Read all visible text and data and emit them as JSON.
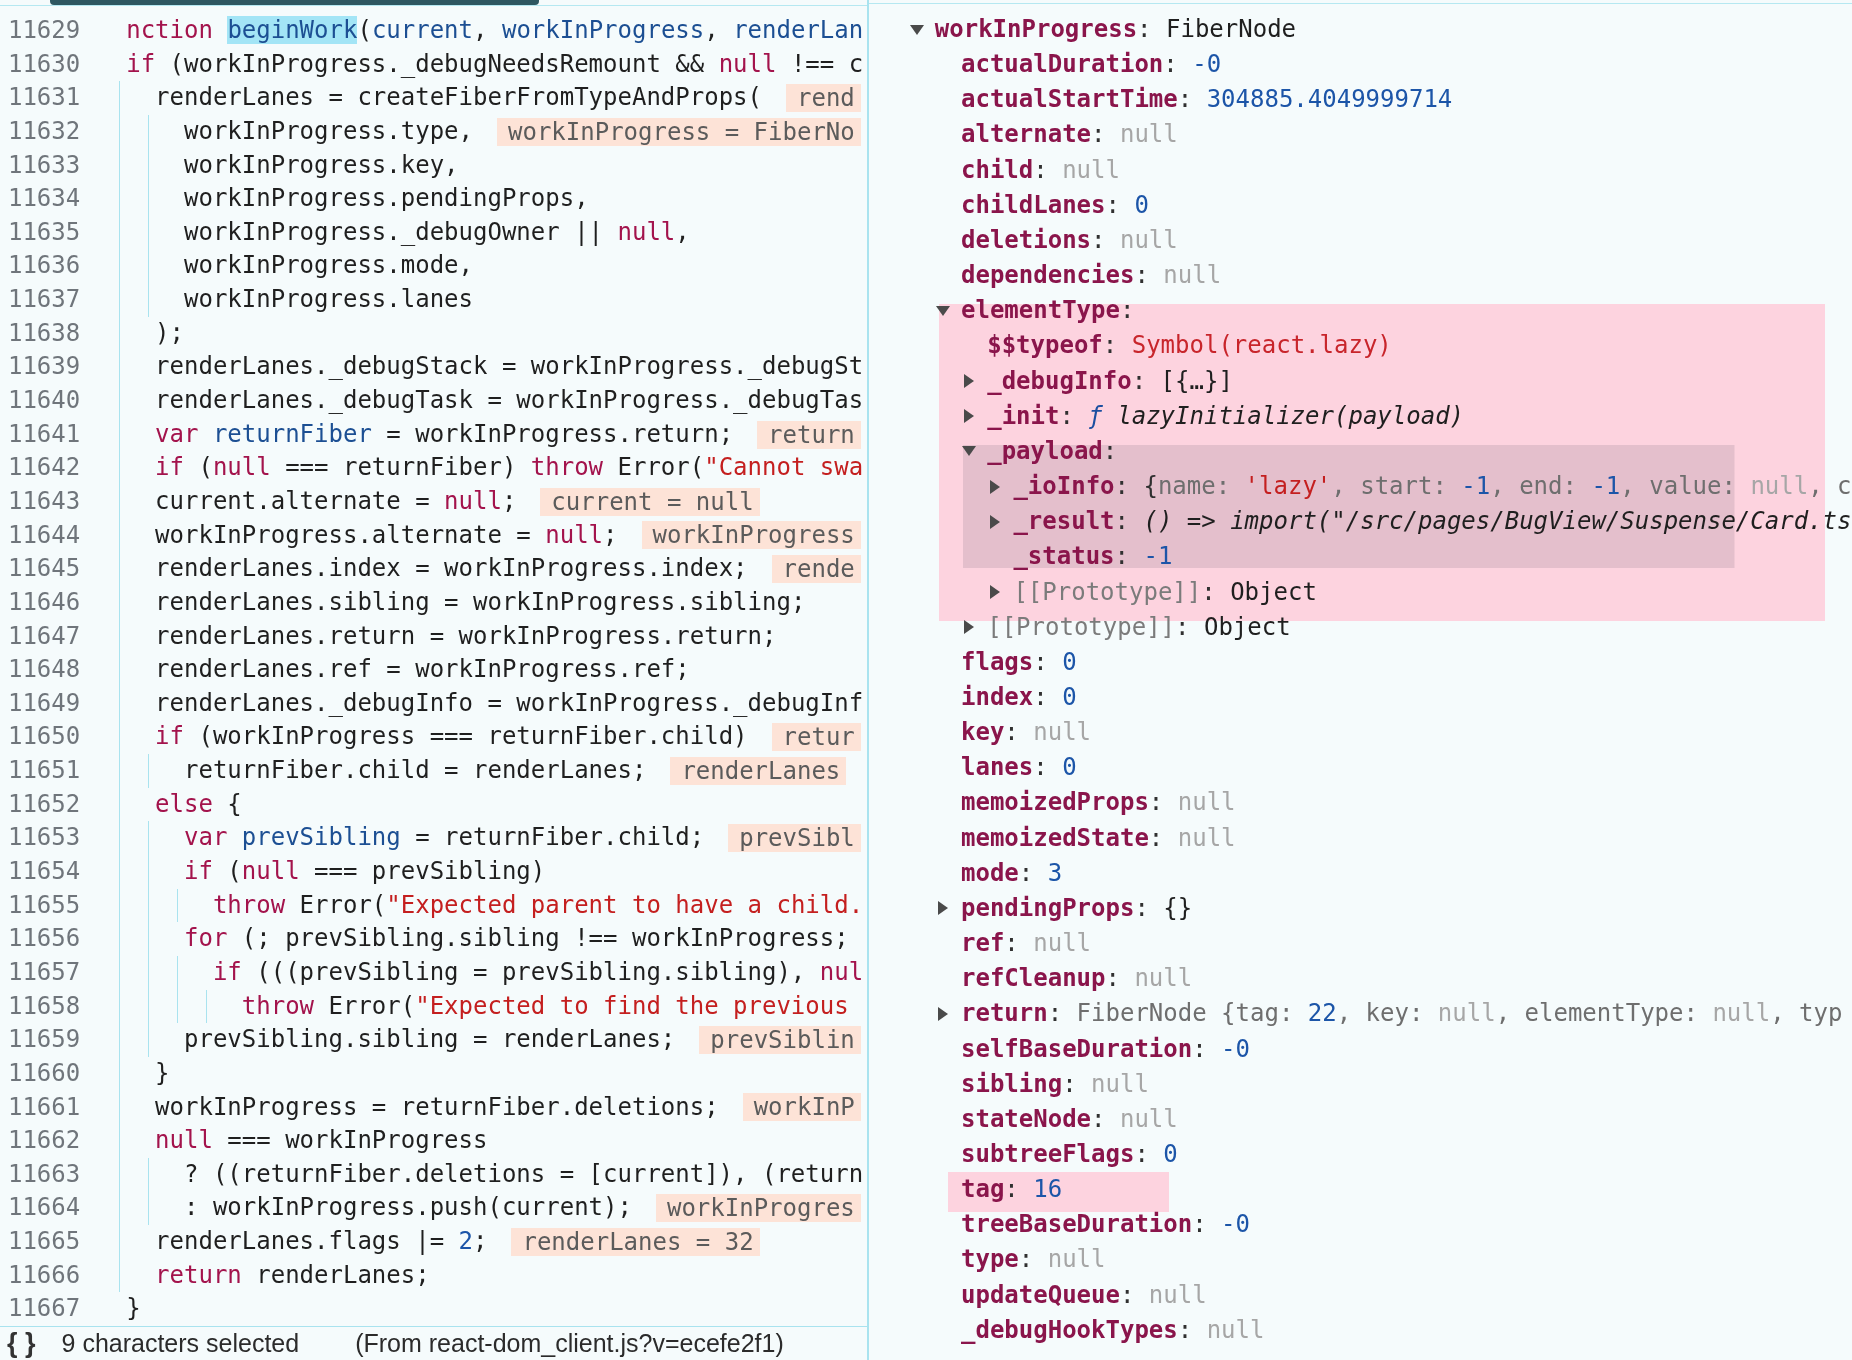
{
  "editor": {
    "lines": [
      {
        "number": "11629",
        "parts": [
          {
            "kind": "keyword",
            "text": "nction "
          },
          {
            "kind": "selection",
            "text": "beginWork"
          },
          {
            "kind": "plain",
            "text": "("
          },
          {
            "kind": "def",
            "text": "current"
          },
          {
            "kind": "plain",
            "text": ", "
          },
          {
            "kind": "def",
            "text": "workInProgress"
          },
          {
            "kind": "plain",
            "text": ", "
          },
          {
            "kind": "def",
            "text": "renderLan"
          }
        ]
      },
      {
        "number": "11630",
        "parts": [
          {
            "kind": "keyword",
            "text": "if"
          },
          {
            "kind": "plain",
            "text": " (workInProgress._debugNeedsRemount && "
          },
          {
            "kind": "keyword",
            "text": "null"
          },
          {
            "kind": "plain",
            "text": " !== c"
          }
        ],
        "children": [
          {
            "number": "11631",
            "parts": [
              {
                "kind": "plain",
                "text": "renderLanes = createFiberFromTypeAndProps("
              }
            ],
            "inline_value": "rend",
            "children": [
              {
                "number": "11632",
                "parts": [
                  {
                    "kind": "plain",
                    "text": "workInProgress.type,"
                  }
                ],
                "inline_value": "workInProgress = FiberNo"
              },
              {
                "number": "11633",
                "parts": [
                  {
                    "kind": "plain",
                    "text": "workInProgress.key,"
                  }
                ]
              },
              {
                "number": "11634",
                "parts": [
                  {
                    "kind": "plain",
                    "text": "workInProgress.pendingProps,"
                  }
                ]
              },
              {
                "number": "11635",
                "parts": [
                  {
                    "kind": "plain",
                    "text": "workInProgress._debugOwner || "
                  },
                  {
                    "kind": "keyword",
                    "text": "null"
                  },
                  {
                    "kind": "plain",
                    "text": ","
                  }
                ]
              },
              {
                "number": "11636",
                "parts": [
                  {
                    "kind": "plain",
                    "text": "workInProgress.mode,"
                  }
                ]
              },
              {
                "number": "11637",
                "parts": [
                  {
                    "kind": "plain",
                    "text": "workInProgress.lanes"
                  }
                ]
              }
            ]
          },
          {
            "number": "11638",
            "parts": [
              {
                "kind": "plain",
                "text": ");"
              }
            ]
          },
          {
            "number": "11639",
            "parts": [
              {
                "kind": "plain",
                "text": "renderLanes._debugStack = workInProgress._debugSt"
              }
            ]
          },
          {
            "number": "11640",
            "parts": [
              {
                "kind": "plain",
                "text": "renderLanes._debugTask = workInProgress._debugTas"
              }
            ]
          },
          {
            "number": "11641",
            "parts": [
              {
                "kind": "keyword",
                "text": "var "
              },
              {
                "kind": "def",
                "text": "returnFiber"
              },
              {
                "kind": "plain",
                "text": " = workInProgress.return;"
              }
            ],
            "inline_value": "return"
          },
          {
            "number": "11642",
            "parts": [
              {
                "kind": "keyword",
                "text": "if"
              },
              {
                "kind": "plain",
                "text": " ("
              },
              {
                "kind": "keyword",
                "text": "null"
              },
              {
                "kind": "plain",
                "text": " === returnFiber) "
              },
              {
                "kind": "keyword",
                "text": "throw"
              },
              {
                "kind": "plain",
                "text": " Error("
              },
              {
                "kind": "string",
                "text": "\"Cannot swa"
              }
            ]
          },
          {
            "number": "11643",
            "parts": [
              {
                "kind": "plain",
                "text": "current.alternate = "
              },
              {
                "kind": "keyword",
                "text": "null"
              },
              {
                "kind": "plain",
                "text": ";"
              }
            ],
            "inline_value": "current = null"
          },
          {
            "number": "11644",
            "parts": [
              {
                "kind": "plain",
                "text": "workInProgress.alternate = "
              },
              {
                "kind": "keyword",
                "text": "null"
              },
              {
                "kind": "plain",
                "text": ";"
              }
            ],
            "inline_value": "workInProgress"
          },
          {
            "number": "11645",
            "parts": [
              {
                "kind": "plain",
                "text": "renderLanes.index = workInProgress.index;"
              }
            ],
            "inline_value": "rende"
          },
          {
            "number": "11646",
            "parts": [
              {
                "kind": "plain",
                "text": "renderLanes.sibling = workInProgress.sibling;"
              }
            ]
          },
          {
            "number": "11647",
            "parts": [
              {
                "kind": "plain",
                "text": "renderLanes.return = workInProgress.return;"
              }
            ]
          },
          {
            "number": "11648",
            "parts": [
              {
                "kind": "plain",
                "text": "renderLanes.ref = workInProgress.ref;"
              }
            ]
          },
          {
            "number": "11649",
            "parts": [
              {
                "kind": "plain",
                "text": "renderLanes._debugInfo = workInProgress._debugInf"
              }
            ]
          },
          {
            "number": "11650",
            "parts": [
              {
                "kind": "keyword",
                "text": "if"
              },
              {
                "kind": "plain",
                "text": " (workInProgress === returnFiber.child)"
              }
            ],
            "inline_value": "retur",
            "children": [
              {
                "number": "11651",
                "parts": [
                  {
                    "kind": "plain",
                    "text": "returnFiber.child = renderLanes;"
                  }
                ],
                "inline_value": "renderLanes"
              }
            ]
          },
          {
            "number": "11652",
            "parts": [
              {
                "kind": "keyword",
                "text": "else"
              },
              {
                "kind": "plain",
                "text": " {"
              }
            ],
            "children": [
              {
                "number": "11653",
                "parts": [
                  {
                    "kind": "keyword",
                    "text": "var "
                  },
                  {
                    "kind": "def",
                    "text": "prevSibling"
                  },
                  {
                    "kind": "plain",
                    "text": " = returnFiber.child;"
                  }
                ],
                "inline_value": "prevSibl"
              },
              {
                "number": "11654",
                "parts": [
                  {
                    "kind": "keyword",
                    "text": "if"
                  },
                  {
                    "kind": "plain",
                    "text": " ("
                  },
                  {
                    "kind": "keyword",
                    "text": "null"
                  },
                  {
                    "kind": "plain",
                    "text": " === prevSibling)"
                  }
                ],
                "children": [
                  {
                    "number": "11655",
                    "parts": [
                      {
                        "kind": "keyword",
                        "text": "throw"
                      },
                      {
                        "kind": "plain",
                        "text": " Error("
                      },
                      {
                        "kind": "string",
                        "text": "\"Expected parent to have a child."
                      }
                    ]
                  }
                ]
              },
              {
                "number": "11656",
                "parts": [
                  {
                    "kind": "keyword",
                    "text": "for"
                  },
                  {
                    "kind": "plain",
                    "text": " (; prevSibling.sibling !== workInProgress;"
                  }
                ],
                "children": [
                  {
                    "number": "11657",
                    "parts": [
                      {
                        "kind": "keyword",
                        "text": "if"
                      },
                      {
                        "kind": "plain",
                        "text": " (((prevSibling = prevSibling.sibling), "
                      },
                      {
                        "kind": "keyword",
                        "text": "nul"
                      }
                    ],
                    "children": [
                      {
                        "number": "11658",
                        "parts": [
                          {
                            "kind": "keyword",
                            "text": "throw"
                          },
                          {
                            "kind": "plain",
                            "text": " Error("
                          },
                          {
                            "kind": "string",
                            "text": "\"Expected to find the previous"
                          }
                        ]
                      }
                    ]
                  }
                ]
              },
              {
                "number": "11659",
                "parts": [
                  {
                    "kind": "plain",
                    "text": "prevSibling.sibling = renderLanes;"
                  }
                ],
                "inline_value": "prevSiblin"
              }
            ]
          },
          {
            "number": "11660",
            "parts": [
              {
                "kind": "plain",
                "text": "}"
              }
            ]
          },
          {
            "number": "11661",
            "parts": [
              {
                "kind": "plain",
                "text": "workInProgress = returnFiber.deletions;"
              }
            ],
            "inline_value": "workInP"
          },
          {
            "number": "11662",
            "parts": [
              {
                "kind": "keyword",
                "text": "null"
              },
              {
                "kind": "plain",
                "text": " === workInProgress"
              }
            ],
            "children": [
              {
                "number": "11663",
                "parts": [
                  {
                    "kind": "plain",
                    "text": "? ((returnFiber.deletions = [current]), (return"
                  }
                ]
              },
              {
                "number": "11664",
                "parts": [
                  {
                    "kind": "plain",
                    "text": ": workInProgress.push(current);"
                  }
                ],
                "inline_value": "workInProgres"
              }
            ]
          },
          {
            "number": "11665",
            "parts": [
              {
                "kind": "plain",
                "text": "renderLanes.flags |= "
              },
              {
                "kind": "number",
                "text": "2"
              },
              {
                "kind": "plain",
                "text": ";"
              }
            ],
            "inline_value": "renderLanes = 32"
          },
          {
            "number": "11666",
            "parts": [
              {
                "kind": "keyword",
                "text": "return"
              },
              {
                "kind": "plain",
                "text": " renderLanes;"
              }
            ]
          }
        ]
      },
      {
        "number": "11667",
        "parts": [
          {
            "kind": "plain",
            "text": "}"
          }
        ]
      }
    ]
  },
  "status_bar": {
    "format_button": "{ }",
    "selection": "9 characters selected",
    "source": "(From react-dom_client.js?v=ecefe2f1)"
  },
  "scope": {
    "entries": [
      {
        "kind": "node",
        "expanded": true,
        "highlighted": false,
        "parts": [
          {
            "kind": "key",
            "text": "workInProgress"
          },
          {
            "kind": "punct",
            "text": ": "
          },
          {
            "kind": "plain",
            "text": "FiberNode"
          }
        ],
        "children": [
          {
            "kind": "leaf",
            "highlighted": false,
            "parts": [
              {
                "kind": "key",
                "text": "actualDuration"
              },
              {
                "kind": "punct",
                "text": ": "
              },
              {
                "kind": "number",
                "text": "-0"
              }
            ]
          },
          {
            "kind": "leaf",
            "highlighted": false,
            "parts": [
              {
                "kind": "key",
                "text": "actualStartTime"
              },
              {
                "kind": "punct",
                "text": ": "
              },
              {
                "kind": "number",
                "text": "304885.4049999714"
              }
            ]
          },
          {
            "kind": "leaf",
            "highlighted": false,
            "parts": [
              {
                "kind": "key",
                "text": "alternate"
              },
              {
                "kind": "punct",
                "text": ": "
              },
              {
                "kind": "null",
                "text": "null"
              }
            ]
          },
          {
            "kind": "leaf",
            "highlighted": false,
            "parts": [
              {
                "kind": "key",
                "text": "child"
              },
              {
                "kind": "punct",
                "text": ": "
              },
              {
                "kind": "null",
                "text": "null"
              }
            ]
          },
          {
            "kind": "leaf",
            "highlighted": false,
            "parts": [
              {
                "kind": "key",
                "text": "childLanes"
              },
              {
                "kind": "punct",
                "text": ": "
              },
              {
                "kind": "number",
                "text": "0"
              }
            ]
          },
          {
            "kind": "leaf",
            "highlighted": false,
            "parts": [
              {
                "kind": "key",
                "text": "deletions"
              },
              {
                "kind": "punct",
                "text": ": "
              },
              {
                "kind": "null",
                "text": "null"
              }
            ]
          },
          {
            "kind": "leaf",
            "highlighted": false,
            "parts": [
              {
                "kind": "key",
                "text": "dependencies"
              },
              {
                "kind": "punct",
                "text": ": "
              },
              {
                "kind": "null",
                "text": "null"
              }
            ]
          },
          {
            "kind": "node",
            "expanded": true,
            "highlighted": true,
            "parts": [
              {
                "kind": "key",
                "text": "elementType"
              },
              {
                "kind": "punct",
                "text": ":"
              }
            ],
            "children": [
              {
                "kind": "leaf",
                "highlighted": true,
                "emphasized": false,
                "parts": [
                  {
                    "kind": "key",
                    "text": "$$typeof"
                  },
                  {
                    "kind": "punct",
                    "text": ": "
                  },
                  {
                    "kind": "symbol",
                    "text": "Symbol(react.lazy)"
                  }
                ]
              },
              {
                "kind": "node",
                "expanded": false,
                "highlighted": true,
                "emphasized": false,
                "parts": [
                  {
                    "kind": "key",
                    "text": "_debugInfo"
                  },
                  {
                    "kind": "punct",
                    "text": ": "
                  },
                  {
                    "kind": "plain",
                    "text": "[{…}]"
                  }
                ]
              },
              {
                "kind": "node",
                "expanded": false,
                "highlighted": true,
                "emphasized": false,
                "parts": [
                  {
                    "kind": "key",
                    "text": "_init"
                  },
                  {
                    "kind": "punct",
                    "text": ": "
                  },
                  {
                    "kind": "func",
                    "text": "ƒ"
                  },
                  {
                    "kind": "italic",
                    "text": " lazyInitializer(payload)"
                  }
                ]
              },
              {
                "kind": "node",
                "expanded": true,
                "highlighted": true,
                "emphasized": true,
                "parts": [
                  {
                    "kind": "key",
                    "text": "_payload"
                  },
                  {
                    "kind": "punct",
                    "text": ":"
                  }
                ],
                "children": [
                  {
                    "kind": "node",
                    "expanded": false,
                    "highlighted": true,
                    "emphasized": true,
                    "parts": [
                      {
                        "kind": "key",
                        "text": "_ioInfo"
                      },
                      {
                        "kind": "punct",
                        "text": ": {"
                      },
                      {
                        "kind": "preview",
                        "text": "name: "
                      },
                      {
                        "kind": "string",
                        "text": "'lazy'"
                      },
                      {
                        "kind": "preview",
                        "text": ", start: "
                      },
                      {
                        "kind": "number",
                        "text": "-1"
                      },
                      {
                        "kind": "preview",
                        "text": ", end: "
                      },
                      {
                        "kind": "number",
                        "text": "-1"
                      },
                      {
                        "kind": "preview",
                        "text": ", value: "
                      },
                      {
                        "kind": "null",
                        "text": "null"
                      },
                      {
                        "kind": "preview",
                        "text": ", c"
                      }
                    ]
                  },
                  {
                    "kind": "node",
                    "expanded": false,
                    "highlighted": true,
                    "emphasized": true,
                    "parts": [
                      {
                        "kind": "key",
                        "text": "_result"
                      },
                      {
                        "kind": "punct",
                        "text": ": "
                      },
                      {
                        "kind": "italic",
                        "text": "() => import(\"/src/pages/BugView/Suspense/Card.ts"
                      }
                    ]
                  },
                  {
                    "kind": "leaf",
                    "highlighted": true,
                    "emphasized": true,
                    "parts": [
                      {
                        "kind": "key",
                        "text": "_status"
                      },
                      {
                        "kind": "punct",
                        "text": ": "
                      },
                      {
                        "kind": "number",
                        "text": "-1"
                      }
                    ]
                  },
                  {
                    "kind": "node",
                    "expanded": false,
                    "highlighted": true,
                    "emphasized": false,
                    "parts": [
                      {
                        "kind": "internal",
                        "text": "[[Prototype]]"
                      },
                      {
                        "kind": "punct",
                        "text": ": "
                      },
                      {
                        "kind": "plain",
                        "text": "Object"
                      }
                    ]
                  }
                ]
              },
              {
                "kind": "node",
                "expanded": false,
                "highlighted": false,
                "emphasized": false,
                "parts": [
                  {
                    "kind": "internal",
                    "text": "[[Prototype]]"
                  },
                  {
                    "kind": "punct",
                    "text": ": "
                  },
                  {
                    "kind": "plain",
                    "text": "Object"
                  }
                ]
              }
            ]
          },
          {
            "kind": "leaf",
            "highlighted": false,
            "parts": [
              {
                "kind": "key",
                "text": "flags"
              },
              {
                "kind": "punct",
                "text": ": "
              },
              {
                "kind": "number",
                "text": "0"
              }
            ]
          },
          {
            "kind": "leaf",
            "highlighted": false,
            "parts": [
              {
                "kind": "key",
                "text": "index"
              },
              {
                "kind": "punct",
                "text": ": "
              },
              {
                "kind": "number",
                "text": "0"
              }
            ]
          },
          {
            "kind": "leaf",
            "highlighted": false,
            "parts": [
              {
                "kind": "key",
                "text": "key"
              },
              {
                "kind": "punct",
                "text": ": "
              },
              {
                "kind": "null",
                "text": "null"
              }
            ]
          },
          {
            "kind": "leaf",
            "highlighted": false,
            "parts": [
              {
                "kind": "key",
                "text": "lanes"
              },
              {
                "kind": "punct",
                "text": ": "
              },
              {
                "kind": "number",
                "text": "0"
              }
            ]
          },
          {
            "kind": "leaf",
            "highlighted": false,
            "parts": [
              {
                "kind": "key",
                "text": "memoizedProps"
              },
              {
                "kind": "punct",
                "text": ": "
              },
              {
                "kind": "null",
                "text": "null"
              }
            ]
          },
          {
            "kind": "leaf",
            "highlighted": false,
            "parts": [
              {
                "kind": "key",
                "text": "memoizedState"
              },
              {
                "kind": "punct",
                "text": ": "
              },
              {
                "kind": "null",
                "text": "null"
              }
            ]
          },
          {
            "kind": "leaf",
            "highlighted": false,
            "parts": [
              {
                "kind": "key",
                "text": "mode"
              },
              {
                "kind": "punct",
                "text": ": "
              },
              {
                "kind": "number",
                "text": "3"
              }
            ]
          },
          {
            "kind": "node",
            "expanded": false,
            "highlighted": false,
            "parts": [
              {
                "kind": "key",
                "text": "pendingProps"
              },
              {
                "kind": "punct",
                "text": ": "
              },
              {
                "kind": "plain",
                "text": "{}"
              }
            ]
          },
          {
            "kind": "leaf",
            "highlighted": false,
            "parts": [
              {
                "kind": "key",
                "text": "ref"
              },
              {
                "kind": "punct",
                "text": ": "
              },
              {
                "kind": "null",
                "text": "null"
              }
            ]
          },
          {
            "kind": "leaf",
            "highlighted": false,
            "parts": [
              {
                "kind": "key",
                "text": "refCleanup"
              },
              {
                "kind": "punct",
                "text": ": "
              },
              {
                "kind": "null",
                "text": "null"
              }
            ]
          },
          {
            "kind": "node",
            "expanded": false,
            "highlighted": false,
            "parts": [
              {
                "kind": "key",
                "text": "return"
              },
              {
                "kind": "punct",
                "text": ": "
              },
              {
                "kind": "preview",
                "text": "FiberNode {tag: "
              },
              {
                "kind": "number",
                "text": "22"
              },
              {
                "kind": "preview",
                "text": ", key: "
              },
              {
                "kind": "null",
                "text": "null"
              },
              {
                "kind": "preview",
                "text": ", elementType: "
              },
              {
                "kind": "null",
                "text": "null"
              },
              {
                "kind": "preview",
                "text": ", typ"
              }
            ]
          },
          {
            "kind": "leaf",
            "highlighted": false,
            "parts": [
              {
                "kind": "key",
                "text": "selfBaseDuration"
              },
              {
                "kind": "punct",
                "text": ": "
              },
              {
                "kind": "number",
                "text": "-0"
              }
            ]
          },
          {
            "kind": "leaf",
            "highlighted": false,
            "parts": [
              {
                "kind": "key",
                "text": "sibling"
              },
              {
                "kind": "punct",
                "text": ": "
              },
              {
                "kind": "null",
                "text": "null"
              }
            ]
          },
          {
            "kind": "leaf",
            "highlighted": false,
            "parts": [
              {
                "kind": "key",
                "text": "stateNode"
              },
              {
                "kind": "punct",
                "text": ": "
              },
              {
                "kind": "null",
                "text": "null"
              }
            ]
          },
          {
            "kind": "leaf",
            "highlighted": false,
            "parts": [
              {
                "kind": "key",
                "text": "subtreeFlags"
              },
              {
                "kind": "punct",
                "text": ": "
              },
              {
                "kind": "number",
                "text": "0"
              }
            ]
          },
          {
            "kind": "leaf",
            "highlighted": true,
            "parts": [
              {
                "kind": "key",
                "text": "tag"
              },
              {
                "kind": "punct",
                "text": ": "
              },
              {
                "kind": "number",
                "text": "16"
              }
            ]
          },
          {
            "kind": "leaf",
            "highlighted": false,
            "parts": [
              {
                "kind": "key",
                "text": "treeBaseDuration"
              },
              {
                "kind": "punct",
                "text": ": "
              },
              {
                "kind": "number",
                "text": "-0"
              }
            ]
          },
          {
            "kind": "leaf",
            "highlighted": false,
            "parts": [
              {
                "kind": "key",
                "text": "type"
              },
              {
                "kind": "punct",
                "text": ": "
              },
              {
                "kind": "null",
                "text": "null"
              }
            ]
          },
          {
            "kind": "leaf",
            "highlighted": false,
            "parts": [
              {
                "kind": "key",
                "text": "updateQueue"
              },
              {
                "kind": "punct",
                "text": ": "
              },
              {
                "kind": "null",
                "text": "null"
              }
            ]
          },
          {
            "kind": "leaf",
            "highlighted": false,
            "parts": [
              {
                "kind": "key",
                "text": "_debugHookTypes"
              },
              {
                "kind": "punct",
                "text": ": "
              },
              {
                "kind": "null",
                "text": "null"
              }
            ]
          }
        ]
      }
    ]
  }
}
